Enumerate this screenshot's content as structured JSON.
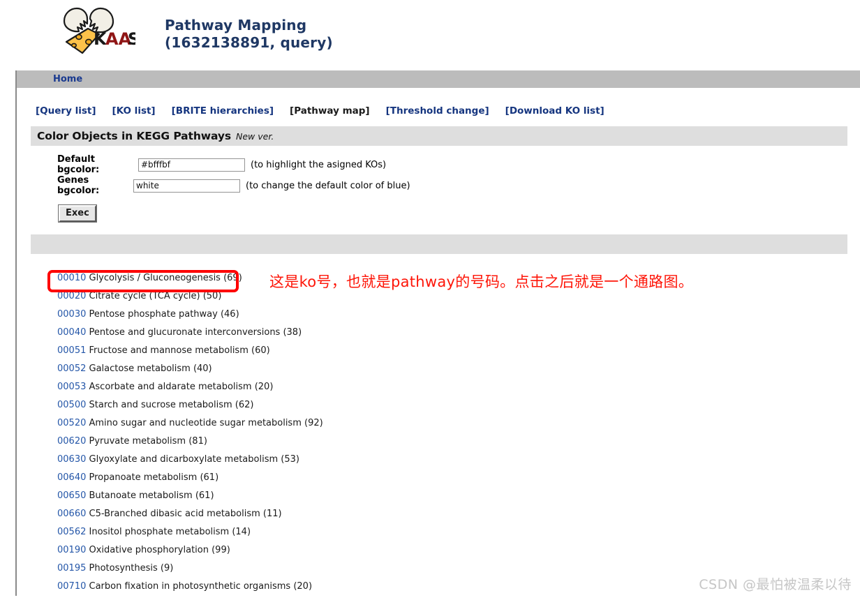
{
  "header": {
    "logo_alt": "KAAS",
    "logo_text_k": "K",
    "logo_text_aa": "AA",
    "logo_text_s": "S",
    "title_line1": "Pathway Mapping",
    "title_line2": "(1632138891, query)",
    "title_color": "#1f3864"
  },
  "navbar": {
    "home_label": "Home"
  },
  "toolbar": {
    "links": [
      {
        "label": "[Query list]",
        "current": false
      },
      {
        "label": "[KO list]",
        "current": false
      },
      {
        "label": "[BRITE hierarchies]",
        "current": false
      },
      {
        "label": "[Pathway map]",
        "current": true
      },
      {
        "label": "[Threshold change]",
        "current": false
      },
      {
        "label": "[Download KO list]",
        "current": false
      }
    ],
    "link_color": "#15357f",
    "current_color": "#1b1b1b"
  },
  "section": {
    "title": "Color Objects in KEGG Pathways",
    "subtitle": "New ver.",
    "bar_color": "#dedede"
  },
  "form": {
    "default_bgcolor_label": "Default bgcolor:",
    "default_bgcolor_value": "#bfffbf",
    "default_bgcolor_placeholder": "#bfffbf",
    "default_bgcolor_hint": "(to highlight the asigned KOs)",
    "genes_bgcolor_label": "Genes bgcolor:",
    "genes_bgcolor_value": "white",
    "genes_bgcolor_placeholder": "white",
    "genes_bgcolor_hint": "(to change the default color of blue)",
    "exec_label": "Exec"
  },
  "pathways": [
    {
      "id": "00010",
      "name": "Glycolysis / Gluconeogenesis (69)"
    },
    {
      "id": "00020",
      "name": "Citrate cycle (TCA cycle) (50)"
    },
    {
      "id": "00030",
      "name": "Pentose phosphate pathway (46)"
    },
    {
      "id": "00040",
      "name": "Pentose and glucuronate interconversions (38)"
    },
    {
      "id": "00051",
      "name": "Fructose and mannose metabolism (60)"
    },
    {
      "id": "00052",
      "name": "Galactose metabolism (40)"
    },
    {
      "id": "00053",
      "name": "Ascorbate and aldarate metabolism (20)"
    },
    {
      "id": "00500",
      "name": "Starch and sucrose metabolism (62)"
    },
    {
      "id": "00520",
      "name": "Amino sugar and nucleotide sugar metabolism (92)"
    },
    {
      "id": "00620",
      "name": "Pyruvate metabolism (81)"
    },
    {
      "id": "00630",
      "name": "Glyoxylate and dicarboxylate metabolism (53)"
    },
    {
      "id": "00640",
      "name": "Propanoate metabolism (61)"
    },
    {
      "id": "00650",
      "name": "Butanoate metabolism (61)"
    },
    {
      "id": "00660",
      "name": "C5-Branched dibasic acid metabolism (11)"
    },
    {
      "id": "00562",
      "name": "Inositol phosphate metabolism (14)"
    },
    {
      "id": "00190",
      "name": "Oxidative phosphorylation (99)"
    },
    {
      "id": "00195",
      "name": "Photosynthesis (9)"
    },
    {
      "id": "00710",
      "name": "Carbon fixation in photosynthetic organisms (20)"
    }
  ],
  "annotation": {
    "text": "这是ko号，也就是pathway的号码。点击之后就是一个通路图。",
    "color": "#fe1508",
    "box_color": "#fe0000"
  },
  "watermark": {
    "text": "CSDN @最怕被温柔以待",
    "color": "#c6c6c6"
  }
}
